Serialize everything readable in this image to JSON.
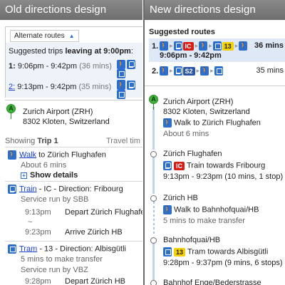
{
  "left": {
    "header": "Old directions design",
    "alt_tab_label": "Alternate routes",
    "suggested_prefix": "Suggested trips ",
    "suggested_bold": "leaving at  9:00pm",
    "suggested_suffix": ":",
    "trips": [
      {
        "num": "1:",
        "times": " 9:06pm - 9:42pm ",
        "duration": "(36 mins)"
      },
      {
        "num": "2:",
        "times": " 9:13pm - 9:42pm ",
        "duration": "(35 mins)"
      }
    ],
    "origin_name": "Zurich Airport (ZRH)",
    "origin_address": "8302 Kloten, Switzerland",
    "showing_prefix": "Showing ",
    "showing_bold": "Trip 1",
    "travel_time_label": "Travel tim",
    "step_walk": {
      "link": "Walk",
      "text": " to Zürich Flughafen",
      "sub": "About 6 mins",
      "show_details": "Show details"
    },
    "step_train": {
      "link": "Train",
      "text": " - IC - Direction: Fribourg",
      "sub": "Service run by SBB",
      "rows": [
        {
          "time": "9:13pm",
          "desc": "Depart Zürich Flughafen"
        },
        {
          "time": "9:23pm",
          "desc": "Arrive Zürich HB"
        }
      ],
      "gap": "~"
    },
    "step_tram": {
      "link": "Tram",
      "text": " - 13 - Direction: Albisgütli",
      "sub1": "5 mins to make transfer",
      "sub2": "Service run by VBZ",
      "rows": [
        {
          "time": "9:28pm",
          "desc": "Depart Zürich HB"
        }
      ]
    }
  },
  "right": {
    "header": "New directions design",
    "title": "Suggested routes",
    "trip1": {
      "num": "1.",
      "badge_ic": "IC",
      "badge_13": "13",
      "duration": "36 mins",
      "times": "9:06pm - 9:42pm"
    },
    "trip2": {
      "num": "2.",
      "badge_s2": "S2",
      "duration": "35 mins"
    },
    "origin_name": "Zurich Airport (ZRH)",
    "origin_address": "8302 Kloten, Switzerland",
    "walk1": "Walk to Zürich Flughafen",
    "walk1_sub": "About 6 mins",
    "stop1": "Zürich Flughafen",
    "train_badge": "IC",
    "train_text": "Train towards Fribourg",
    "train_times": "9:13pm - 9:23pm (10 mins, 1 stop)",
    "stop2": "Zürich HB",
    "walk2": "Walk to Bahnhofquai/HB",
    "walk2_sub": "5 mins to make transfer",
    "stop3": "Bahnhofquai/HB",
    "tram_badge": "13",
    "tram_text": "Tram towards Albisgütli",
    "tram_times": "9:28pm - 9:37pm (9 mins, 6 stops)",
    "stop4": "Bahnhof Enge/Bederstrasse"
  },
  "icons": {
    "walk": "walk-icon",
    "train": "train-icon",
    "tram": "tram-icon",
    "pin": "map-pin-icon"
  },
  "colors": {
    "walk_blue": "#2b6fd1",
    "ic_red": "#d81e14",
    "tram_yellow": "#f5d000",
    "s2_blue": "#2a55a8",
    "pin_green": "#3fb33b"
  }
}
